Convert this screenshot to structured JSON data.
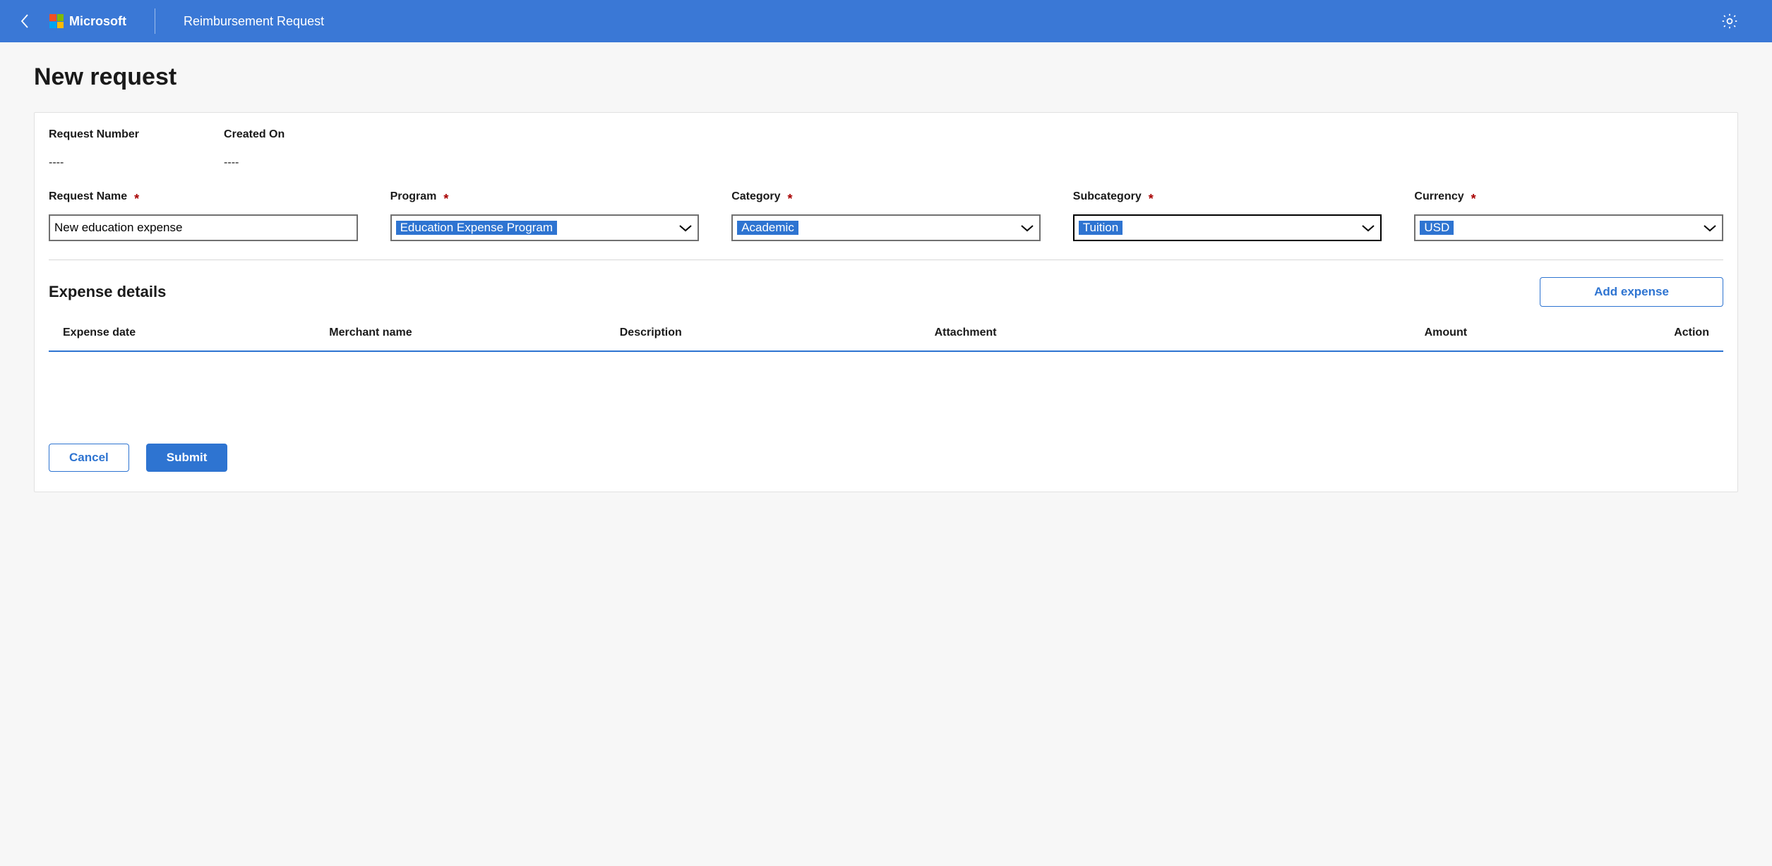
{
  "header": {
    "brand": "Microsoft",
    "app_title": "Reimbursement Request"
  },
  "page": {
    "title": "New request"
  },
  "readonly": {
    "request_number_label": "Request Number",
    "request_number_value": "----",
    "created_on_label": "Created On",
    "created_on_value": "----"
  },
  "form": {
    "request_name": {
      "label": "Request Name",
      "value": "New education expense"
    },
    "program": {
      "label": "Program",
      "selected": "Education Expense Program"
    },
    "category": {
      "label": "Category",
      "selected": "Academic"
    },
    "subcategory": {
      "label": "Subcategory",
      "selected": "Tuition"
    },
    "currency": {
      "label": "Currency",
      "selected": "USD"
    }
  },
  "expense": {
    "section_title": "Expense details",
    "add_button": "Add expense",
    "columns": {
      "date": "Expense date",
      "merchant": "Merchant name",
      "description": "Description",
      "attachment": "Attachment",
      "amount": "Amount",
      "action": "Action"
    }
  },
  "buttons": {
    "cancel": "Cancel",
    "submit": "Submit"
  }
}
